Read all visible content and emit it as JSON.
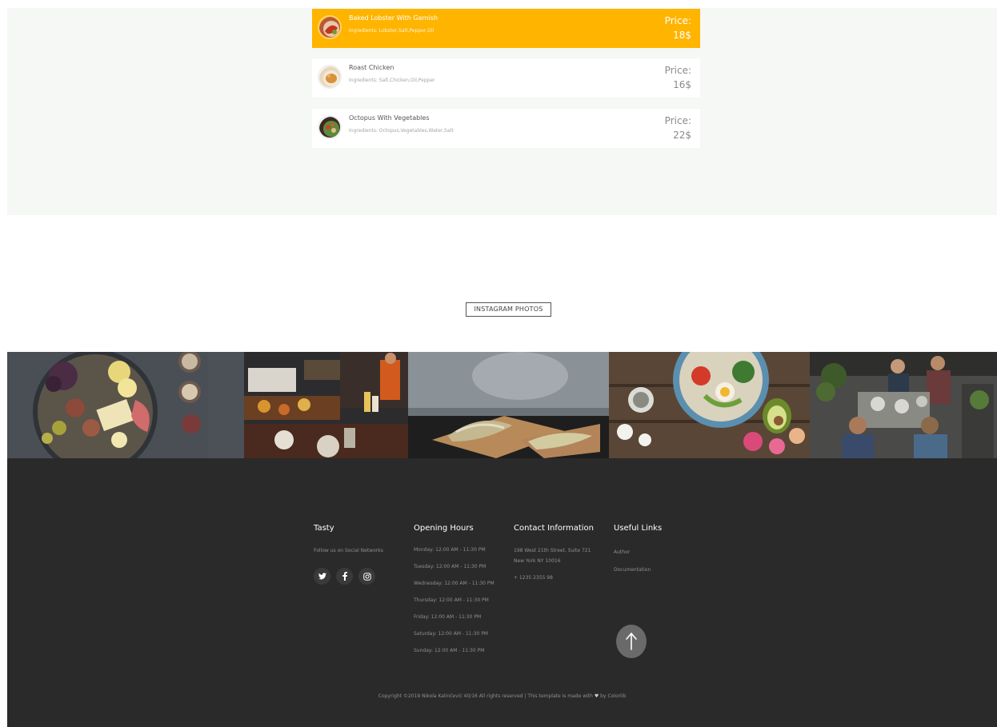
{
  "menu": {
    "price_label": "Price:",
    "items": [
      {
        "name": "Baked Lobster With Garnish",
        "ingredients": "Ingredients: Lobster,Salt,Pepper,Oil",
        "price": "18$",
        "active": true
      },
      {
        "name": "Roast Chicken",
        "ingredients": "Ingredients: Salt,Chicken,Oil,Pepper",
        "price": "16$",
        "active": false
      },
      {
        "name": "Octopus With Vegetables",
        "ingredients": "Ingredients: Octopus,Vegetables,Water,Salt",
        "price": "22$",
        "active": false
      }
    ]
  },
  "instagram": {
    "heading": "INSTAGRAM PHOTOS"
  },
  "footer": {
    "brand": {
      "title": "Tasty",
      "follow": "Follow us on Social Networks"
    },
    "social_icons": [
      "twitter-icon",
      "facebook-icon",
      "instagram-icon"
    ],
    "hours": {
      "title": "Opening Hours",
      "items": [
        "Monday: 12:00 AM - 11:30 PM",
        "Tuesday: 12:00 AM - 11:30 PM",
        "Wednesday: 12:00 AM - 11:30 PM",
        "Thursday: 12:00 AM - 11:30 PM",
        "Friday: 12:00 AM - 11:30 PM",
        "Saturday: 12:00 AM - 11:30 PM",
        "Sunday: 12:00 AM - 11:30 PM"
      ]
    },
    "contact": {
      "title": "Contact Information",
      "address_line1": "198 West 21th Street, Suite 721",
      "address_line2": "New York NY 10016",
      "phone": "+ 1235 2355 98"
    },
    "links": {
      "title": "Useful Links",
      "items": [
        "Author",
        "Documentation"
      ]
    },
    "copyright_text": "Copyright ©2019 Nikola Kalinčević 40/16 All rights reserved | This template is made with",
    "copyright_by": "by Colorlib"
  },
  "colors": {
    "accent": "#ffb400",
    "footer_bg": "#2a2a2a",
    "menu_bg": "#f5f8f5"
  }
}
